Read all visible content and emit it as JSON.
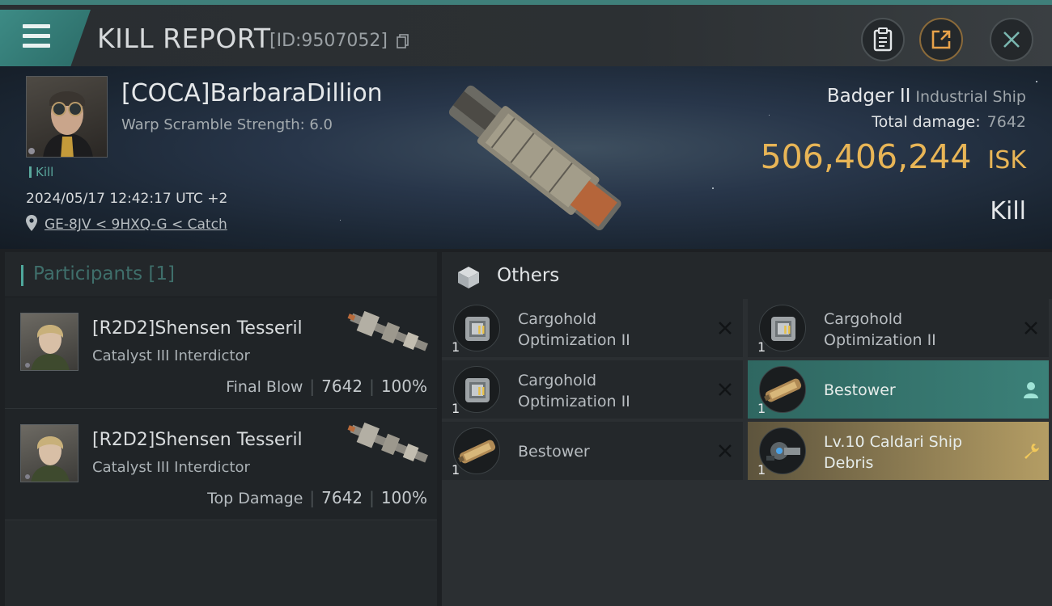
{
  "window": {
    "title": "KILL REPORT",
    "report_id": "[ID:9507052]"
  },
  "victim": {
    "name": "[COCA]BarbaraDillion",
    "warp_scramble": "Warp Scramble Strength: 6.0",
    "kill_tag": "Kill",
    "datetime": "2024/05/17 12:42:17 UTC +2",
    "location": "GE-8JV < 9HXQ-G < Catch",
    "ship_name": "Badger II",
    "ship_class": "Industrial Ship",
    "total_damage_label": "Total damage:",
    "total_damage_value": "7642",
    "isk_value": "506,406,244",
    "isk_unit": "ISK",
    "result": "Kill"
  },
  "participants": {
    "title": "Participants [1]",
    "rows": [
      {
        "name": "[R2D2]Shensen Tesseril",
        "ship": "Catalyst III Interdictor",
        "role": "Final Blow",
        "damage": "7642",
        "percent": "100%"
      },
      {
        "name": "[R2D2]Shensen Tesseril",
        "ship": "Catalyst III Interdictor",
        "role": "Top Damage",
        "damage": "7642",
        "percent": "100%"
      }
    ]
  },
  "others": {
    "title": "Others",
    "items": [
      {
        "name_line1": "Cargohold",
        "name_line2": "Optimization II",
        "qty": "1",
        "status": "destroyed",
        "icon": "cargohold-module-icon"
      },
      {
        "name_line1": "Cargohold",
        "name_line2": "Optimization II",
        "qty": "1",
        "status": "destroyed",
        "icon": "cargohold-module-icon"
      },
      {
        "name_line1": "Cargohold",
        "name_line2": "Optimization II",
        "qty": "1",
        "status": "destroyed",
        "icon": "cargohold-module-icon"
      },
      {
        "name_line1": "Bestower",
        "name_line2": "",
        "qty": "1",
        "status": "dropped",
        "icon": "bestower-ship-icon"
      },
      {
        "name_line1": "Bestower",
        "name_line2": "",
        "qty": "1",
        "status": "destroyed",
        "icon": "bestower-ship-icon"
      },
      {
        "name_line1": "Lv.10 Caldari Ship",
        "name_line2": "Debris",
        "qty": "1",
        "status": "loot",
        "icon": "ship-debris-icon"
      }
    ]
  },
  "module_badge": "II",
  "colors": {
    "accent_teal": "#3d8b85",
    "isk_gold": "#e8b556",
    "dropped_bg": "#3b8078",
    "loot_bg": "#b49d64"
  }
}
